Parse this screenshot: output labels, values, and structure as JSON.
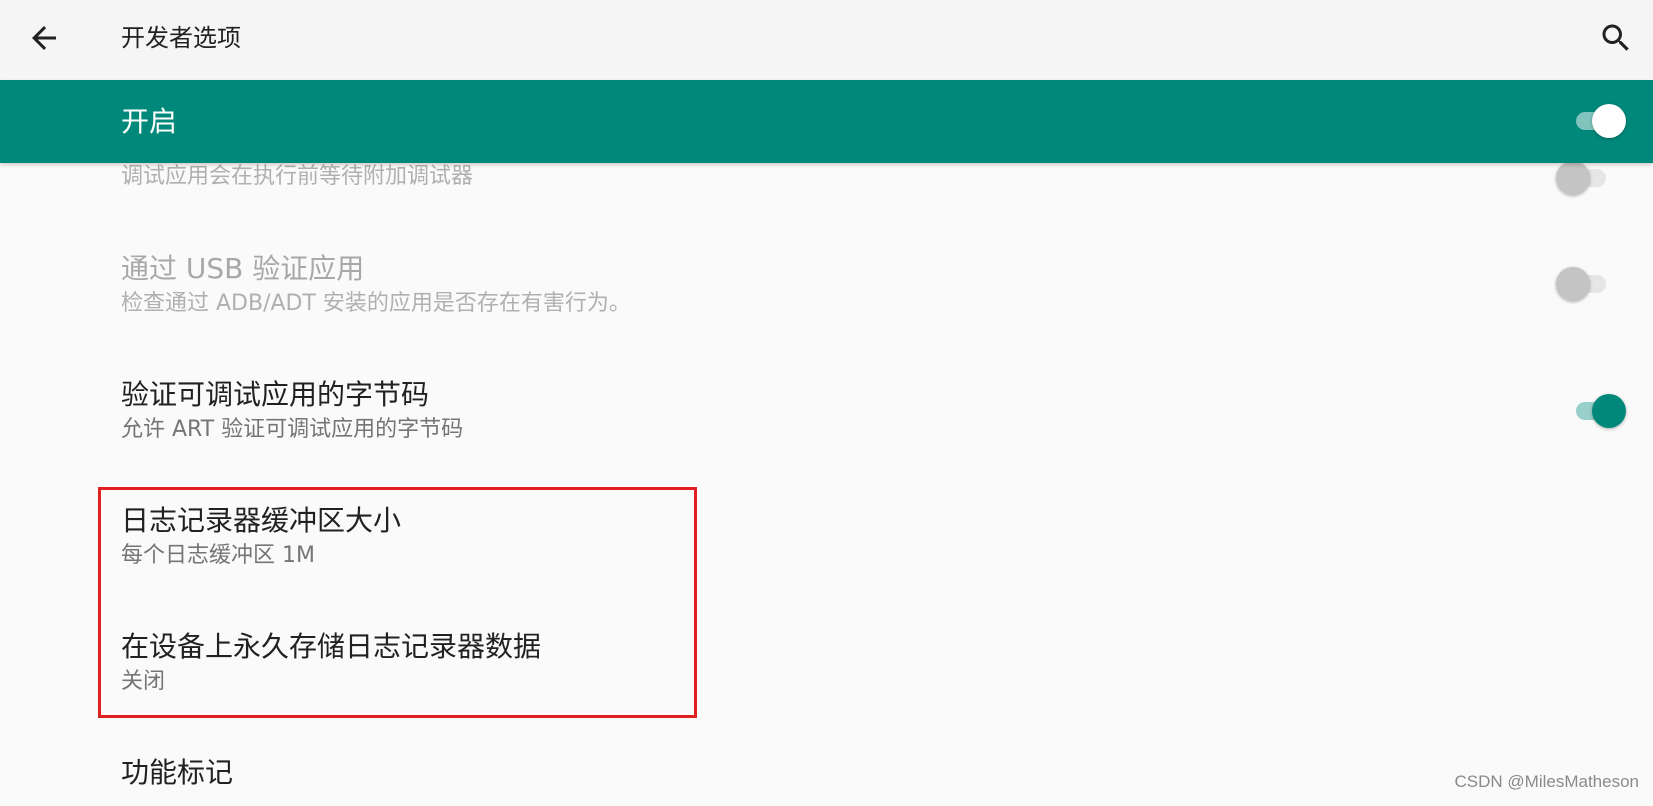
{
  "toolbar": {
    "title": "开发者选项",
    "back_icon": "arrow-back-icon",
    "search_icon": "search-icon"
  },
  "master": {
    "label": "开启",
    "checked": true
  },
  "prefs": {
    "wait_debugger": {
      "summary": "调试应用会在执行前等待附加调试器",
      "enabled": false,
      "checked": false
    },
    "verify_usb": {
      "title": "通过 USB 验证应用",
      "summary": "检查通过 ADB/ADT 安装的应用是否存在有害行为。",
      "enabled": false,
      "checked": false
    },
    "verify_bytecode": {
      "title": "验证可调试应用的字节码",
      "summary": "允许 ART 验证可调试应用的字节码",
      "enabled": true,
      "checked": true
    },
    "logger_buffer": {
      "title": "日志记录器缓冲区大小",
      "summary": "每个日志缓冲区 1M"
    },
    "persist_logger": {
      "title": "在设备上永久存储日志记录器数据",
      "summary": "关闭"
    },
    "feature_flags": {
      "title": "功能标记"
    }
  },
  "watermark": "CSDN @MilesMatheson",
  "colors": {
    "accent": "#00897b",
    "highlight": "#e02020",
    "toolbar_bg": "#f5f5f5",
    "page_bg": "#fafafa"
  }
}
